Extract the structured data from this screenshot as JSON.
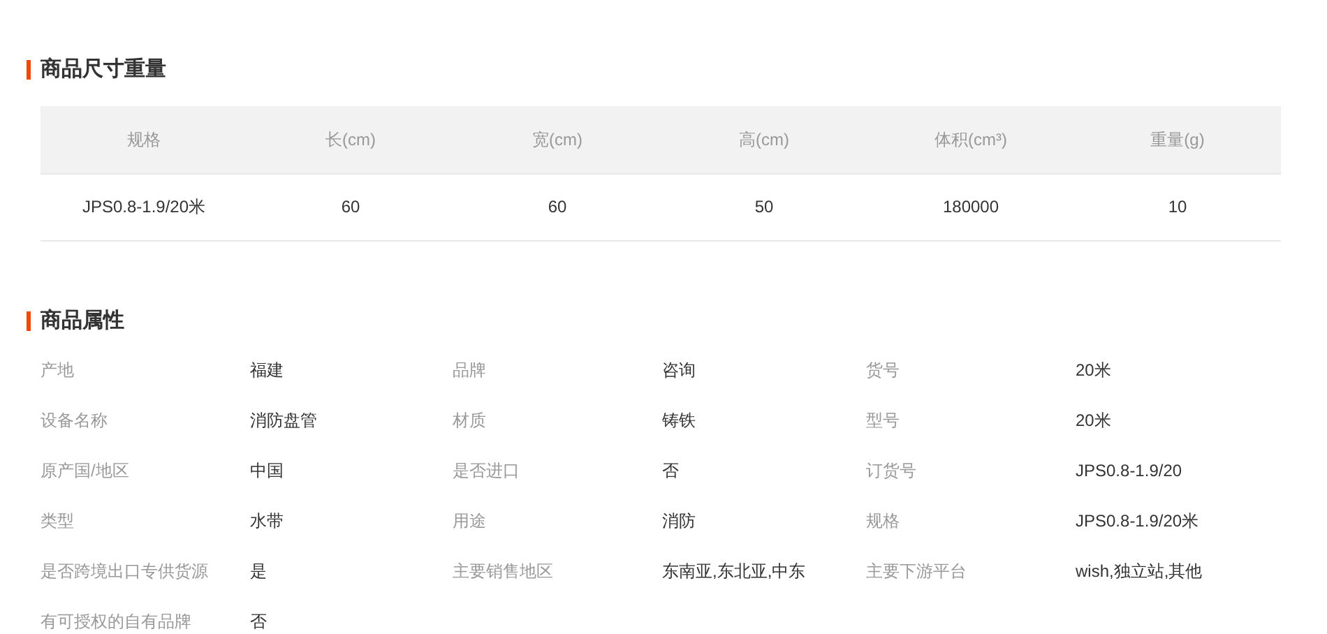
{
  "size_section": {
    "title": "商品尺寸重量",
    "columns": [
      "规格",
      "长(cm)",
      "宽(cm)",
      "高(cm)",
      "体积(cm³)",
      "重量(g)"
    ],
    "rows": [
      [
        "JPS0.8-1.9/20米",
        "60",
        "60",
        "50",
        "180000",
        "10"
      ]
    ]
  },
  "attributes_section": {
    "title": "商品属性",
    "items": [
      {
        "label": "产地",
        "value": "福建"
      },
      {
        "label": "品牌",
        "value": "咨询"
      },
      {
        "label": "货号",
        "value": "20米"
      },
      {
        "label": "设备名称",
        "value": "消防盘管"
      },
      {
        "label": "材质",
        "value": "铸铁"
      },
      {
        "label": "型号",
        "value": "20米"
      },
      {
        "label": "原产国/地区",
        "value": "中国"
      },
      {
        "label": "是否进口",
        "value": "否"
      },
      {
        "label": "订货号",
        "value": "JPS0.8-1.9/20"
      },
      {
        "label": "类型",
        "value": "水带"
      },
      {
        "label": "用途",
        "value": "消防"
      },
      {
        "label": "规格",
        "value": "JPS0.8-1.9/20米"
      },
      {
        "label": "是否跨境出口专供货源",
        "value": "是"
      },
      {
        "label": "主要销售地区",
        "value": "东南亚,东北亚,中东"
      },
      {
        "label": "主要下游平台",
        "value": "wish,独立站,其他"
      },
      {
        "label": "有可授权的自有品牌",
        "value": "否"
      }
    ]
  }
}
